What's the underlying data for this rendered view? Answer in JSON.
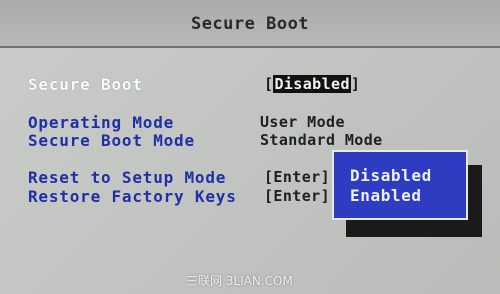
{
  "title": "Secure Boot",
  "settings": {
    "secure_boot": {
      "label": "Secure Boot",
      "bracket_open": "[",
      "value": "Disabled",
      "bracket_close": "]"
    },
    "operating_mode": {
      "label": "Operating Mode",
      "value": "User Mode"
    },
    "secure_boot_mode": {
      "label": "Secure Boot Mode",
      "value": "Standard Mode"
    },
    "reset_setup_mode": {
      "label": "Reset to Setup Mode",
      "value": "[Enter]"
    },
    "restore_factory_keys": {
      "label": "Restore Factory Keys",
      "value": "[Enter]"
    }
  },
  "popup": {
    "options": [
      "Disabled",
      "Enabled"
    ]
  },
  "watermark": "三联网 3LIAN.COM",
  "colors": {
    "background": "#c4c7c3",
    "label_blue": "#1f2fa8",
    "popup_blue": "#2d3cc0",
    "highlight_text": "#ffffff"
  }
}
